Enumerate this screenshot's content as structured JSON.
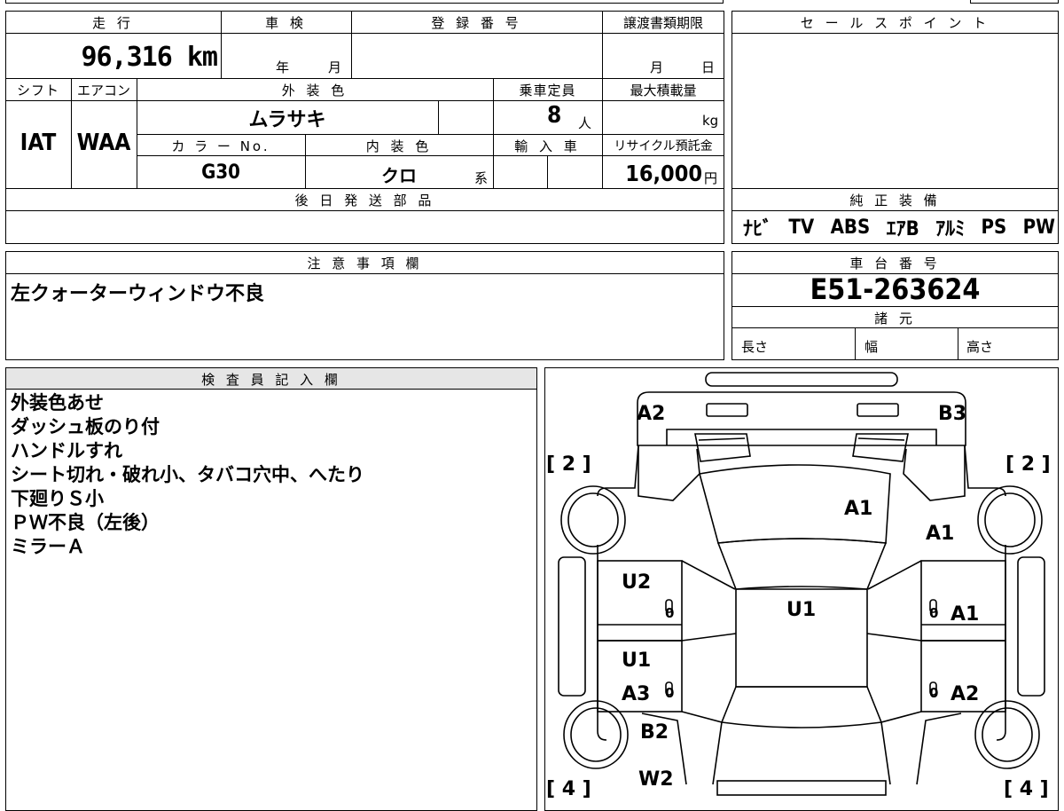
{
  "vehicle": {
    "mileage_label": "走 行",
    "mileage_value": "96,316 km",
    "inspection_label": "車 検",
    "inspection_year_unit": "年",
    "inspection_month_unit": "月",
    "registration_label": "登 録 番 号",
    "deadline_label": "譲渡書類期限",
    "deadline_month_unit": "月",
    "deadline_day_unit": "日",
    "shift_label": "シフト",
    "shift_value": "IAT",
    "ac_label": "エアコン",
    "ac_value": "WAA",
    "exterior_color_label": "外 装 色",
    "exterior_color_value": "ムラサキ",
    "capacity_label": "乗車定員",
    "capacity_value": "8",
    "capacity_unit": "人",
    "max_load_label": "最大積載量",
    "max_load_unit": "kg",
    "color_no_label": "カ ラ ー No.",
    "color_no_value": "G30",
    "interior_color_label": "内 装 色",
    "interior_color_value": "クロ",
    "interior_color_suffix": "系",
    "import_label": "輸 入 車",
    "recycle_label": "リサイクル預託金",
    "recycle_value": "16,000",
    "recycle_unit": "円",
    "later_parts_label": "後 日 発 送 部 品"
  },
  "sales_point": {
    "label": "セ ー ル ス ポ イ ン ト"
  },
  "equipment": {
    "label": "純 正 装 備",
    "items": [
      "ﾅﾋﾞ",
      "TV",
      "ABS",
      "ｴｱB",
      "ｱﾙﾐ",
      "PS",
      "PW"
    ]
  },
  "notes": {
    "label": "注 意 事 項 欄",
    "text": "左クォーターウィンドウ不良"
  },
  "chassis": {
    "label": "車 台 番 号",
    "value": "E51-263624",
    "specs_label": "諸 元",
    "length_label": "長さ",
    "width_label": "幅",
    "height_label": "高さ"
  },
  "inspector": {
    "label": "検 査 員 記 入 欄",
    "lines": [
      "外装色あせ",
      "ダッシュ板のり付",
      "ハンドルすれ",
      "シート切れ・破れ小、タバコ穴中、へたり",
      "下廻りＳ小",
      "ＰＷ不良（左後）",
      "ミラーＡ"
    ]
  },
  "diagram": {
    "marks": {
      "a2_top_left": "A2",
      "b3_top_right": "B3",
      "tire_fl": "[ 2 ]",
      "tire_fr": "[ 2 ]",
      "tire_rl": "[ 4 ]",
      "tire_rr": "[ 4 ]",
      "hood": "A1",
      "front_right_fender": "A1",
      "front_left_door": "U2",
      "roof": "U1",
      "front_right_door": "A1",
      "rear_left_door_u": "U1",
      "rear_left_door_a": "A3",
      "rear_right_door": "A2",
      "rear_left_quarter": "B2",
      "rear_left_w": "W2",
      "door_zero_1": "0",
      "door_zero_2": "0",
      "door_zero_3": "0",
      "door_zero_4": "0"
    }
  }
}
